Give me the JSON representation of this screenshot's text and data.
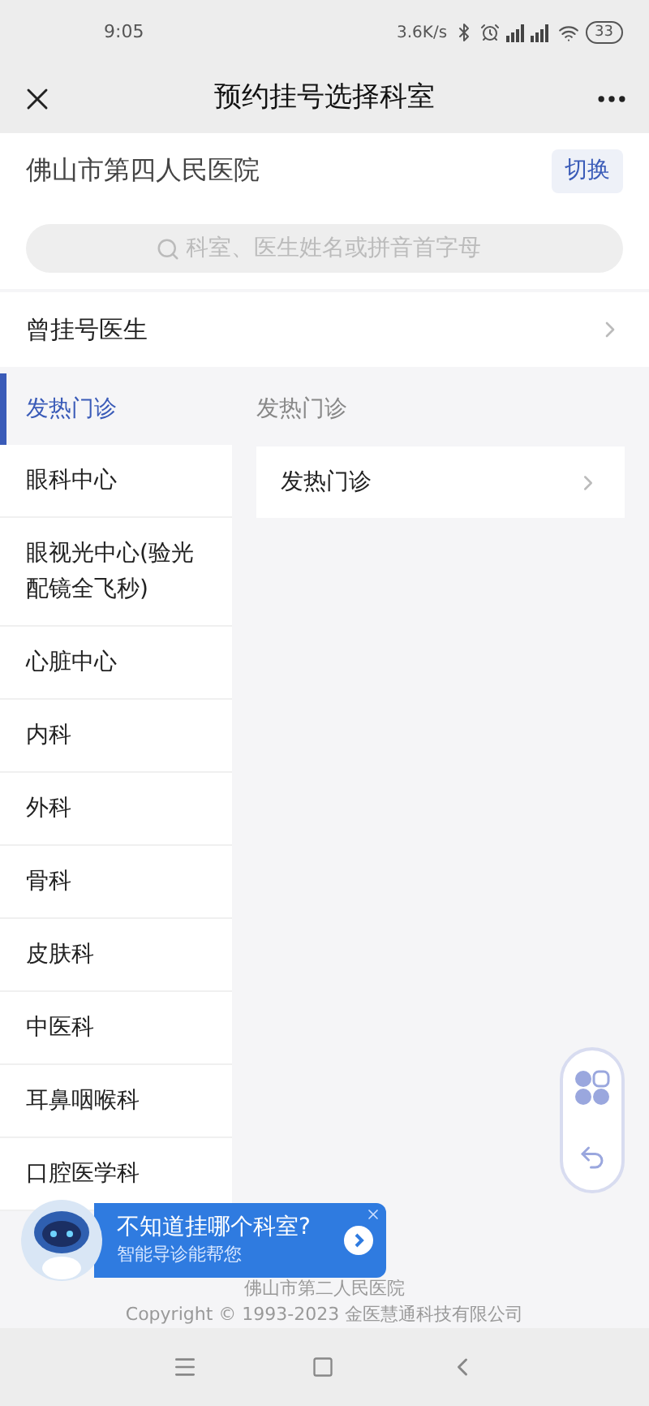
{
  "status_bar": {
    "time": "9:05",
    "speed": "3.6K/s",
    "battery": "33"
  },
  "header": {
    "title": "预约挂号选择科室"
  },
  "hospital": {
    "name": "佛山市第四人民医院",
    "switch_label": "切换"
  },
  "search": {
    "placeholder": "科室、医生姓名或拼音首字母"
  },
  "past_doctors": {
    "label": "曾挂号医生"
  },
  "departments": [
    {
      "label": "发热门诊",
      "selected": true
    },
    {
      "label": "眼科中心",
      "selected": false
    },
    {
      "label": "眼视光中心(验光配镜全飞秒)",
      "selected": false
    },
    {
      "label": "心脏中心",
      "selected": false
    },
    {
      "label": "内科",
      "selected": false
    },
    {
      "label": "外科",
      "selected": false
    },
    {
      "label": "骨科",
      "selected": false
    },
    {
      "label": "皮肤科",
      "selected": false
    },
    {
      "label": "中医科",
      "selected": false
    },
    {
      "label": "耳鼻咽喉科",
      "selected": false
    },
    {
      "label": "口腔医学科",
      "selected": false
    }
  ],
  "section_title": "发热门诊",
  "sub_items": [
    {
      "label": "发热门诊"
    }
  ],
  "banner": {
    "title": "不知道挂哪个科室?",
    "subtitle": "智能导诊能帮您"
  },
  "footer": {
    "hospital": "佛山市第二人民医院",
    "copyright": "Copyright © 1993-2023 金医慧通科技有限公司"
  }
}
